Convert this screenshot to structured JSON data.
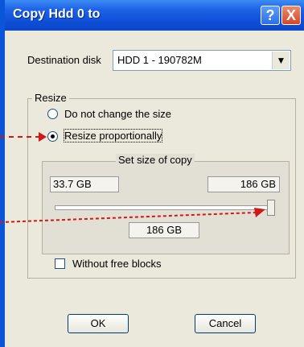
{
  "window": {
    "title": "Copy Hdd 0  to",
    "help_glyph": "?",
    "close_glyph": "X"
  },
  "destination": {
    "label": "Destination disk",
    "selected": "HDD 1 - 190782M"
  },
  "resize": {
    "group_title": "Resize",
    "options": [
      {
        "label": "Do not change the size",
        "checked": false
      },
      {
        "label": "Resize proportionally",
        "checked": true
      }
    ]
  },
  "size": {
    "group_title": "Set size of copy",
    "min": "33.7 GB",
    "max": "186 GB",
    "current": "186 GB",
    "slider_fraction": 1.0
  },
  "options": {
    "without_free_blocks": {
      "label": "Without free blocks",
      "checked": false
    }
  },
  "buttons": {
    "ok": "OK",
    "cancel": "Cancel"
  },
  "colors": {
    "annotation_arrow": "#d01818",
    "title_bar": "#0f4fd8"
  }
}
